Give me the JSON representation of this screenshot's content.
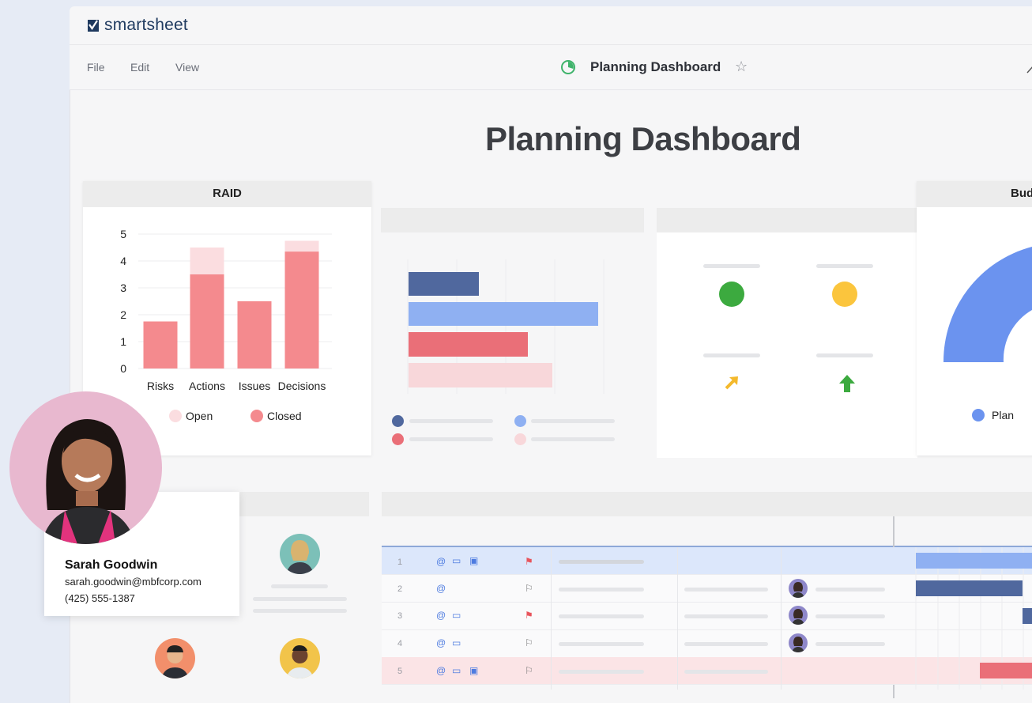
{
  "app": {
    "brand": "smartsheet",
    "menu": {
      "file": "File",
      "edit": "Edit",
      "view": "View"
    },
    "sheet_title": "Planning Dashboard"
  },
  "dashboard": {
    "title": "Planning Dashboard",
    "raid_widget": {
      "header": "RAID"
    },
    "budget_widget": {
      "header_partial": "Bud",
      "legend_plan": "Plan"
    }
  },
  "chart_data": {
    "type": "bar",
    "title": "RAID",
    "categories": [
      "Risks",
      "Actions",
      "Issues",
      "Decisions"
    ],
    "series": [
      {
        "name": "Closed",
        "values": [
          1.75,
          3.5,
          2.5,
          4.35
        ]
      },
      {
        "name": "Open",
        "values": [
          0,
          1.0,
          0,
          0.4
        ]
      }
    ],
    "stacked": true,
    "ylim": [
      0,
      5
    ],
    "yticks": [
      "0",
      "1",
      "2",
      "3",
      "4",
      "5"
    ],
    "legend": [
      "Open",
      "Closed"
    ],
    "colors": {
      "Closed": "#f48a8e",
      "Open": "#fbdde0"
    }
  },
  "grid": {
    "rows": [
      {
        "num": "1",
        "flag": "red",
        "highlight": "blue"
      },
      {
        "num": "2",
        "flag": "outline",
        "highlight": "none"
      },
      {
        "num": "3",
        "flag": "red",
        "highlight": "none"
      },
      {
        "num": "4",
        "flag": "outline",
        "highlight": "none"
      },
      {
        "num": "5",
        "flag": "outline",
        "highlight": "pink"
      }
    ]
  },
  "contact": {
    "name": "Sarah Goodwin",
    "email": "sarah.goodwin@mbfcorp.com",
    "phone": "(425) 555-1387"
  },
  "colors": {
    "brand_green": "#3fb36b",
    "dark_blue": "#50689e",
    "light_blue": "#8fb0f2",
    "red": "#ea6f78",
    "pink": "#f8d7da",
    "green": "#3caa3f",
    "yellow": "#fbc53d"
  }
}
